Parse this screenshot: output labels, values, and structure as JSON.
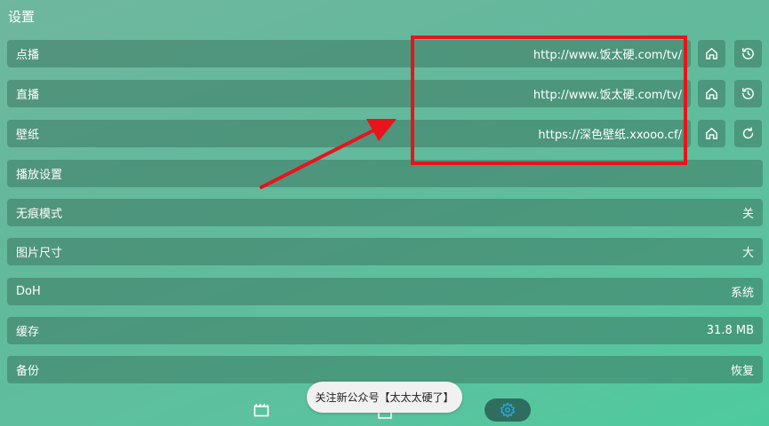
{
  "header": {
    "title": "设置"
  },
  "rows": {
    "vod": {
      "label": "点播",
      "value": "http://www.饭太硬.com/tv/"
    },
    "live": {
      "label": "直播",
      "value": "http://www.饭太硬.com/tv/"
    },
    "wallpaper": {
      "label": "壁纸",
      "value": "https://深色壁纸.xxooo.cf/"
    },
    "playback": {
      "label": "播放设置",
      "value": ""
    },
    "incognito": {
      "label": "无痕模式",
      "value": "关"
    },
    "image_size": {
      "label": "图片尺寸",
      "value": "大"
    },
    "doh": {
      "label": "DoH",
      "value": "系统"
    },
    "cache": {
      "label": "缓存",
      "value": "31.8 MB"
    },
    "backup": {
      "label": "备份",
      "value": "恢复"
    }
  },
  "icons": {
    "home": "home-icon",
    "history": "history-icon",
    "refresh": "refresh-icon",
    "film": "film-icon",
    "settings": "gear-icon"
  },
  "toast": {
    "text": "关注新公众号【太太太硬了】"
  },
  "colors": {
    "accent_red": "#e8141b",
    "nav_active": "#2f6e5e",
    "gear_blue": "#2aa6e0"
  }
}
